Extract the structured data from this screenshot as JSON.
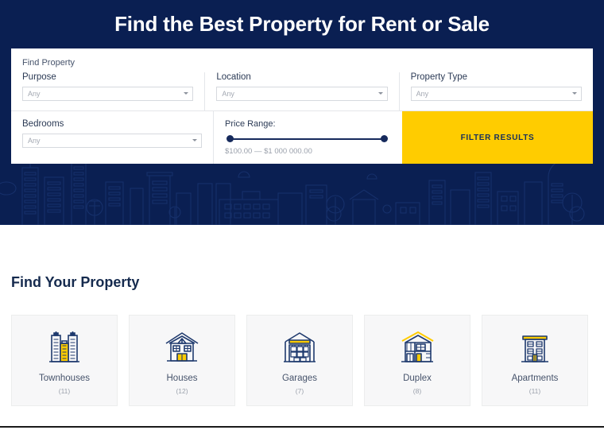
{
  "hero": {
    "title": "Find the Best Property for Rent or Sale",
    "bg_color": "#0a1f52"
  },
  "search_form": {
    "heading": "Find Property",
    "fields": [
      {
        "label": "Purpose",
        "value": "Any",
        "placeholder": "Any"
      },
      {
        "label": "Location",
        "value": "Any",
        "placeholder": "Any"
      },
      {
        "label": "Property Type",
        "value": "Any",
        "placeholder": "Any"
      },
      {
        "label": "Bedrooms",
        "value": "Any",
        "placeholder": "Any"
      }
    ],
    "price_range": {
      "label": "Price Range:",
      "value_text": "$100.00 — $1 000 000.00",
      "min_label": "$100.00",
      "max_label": "$1 000 000.00"
    },
    "submit_label": "FILTER RESULTS",
    "submit_color": "#ffcc00"
  },
  "categories": {
    "title": "Find Your Property",
    "items": [
      {
        "label": "Townhouses",
        "count": "(11)",
        "icon": "townhouses-icon"
      },
      {
        "label": "Houses",
        "count": "(12)",
        "icon": "house-icon"
      },
      {
        "label": "Garages",
        "count": "(7)",
        "icon": "garage-icon"
      },
      {
        "label": "Duplex",
        "count": "(8)",
        "icon": "duplex-icon"
      },
      {
        "label": "Apartments",
        "count": "(11)",
        "icon": "apartment-icon"
      }
    ]
  },
  "theme": {
    "navy": "#0a1f52",
    "yellow": "#ffcc00",
    "icon_stroke": "#1f3a6e",
    "card_bg": "#f7f7f8"
  }
}
